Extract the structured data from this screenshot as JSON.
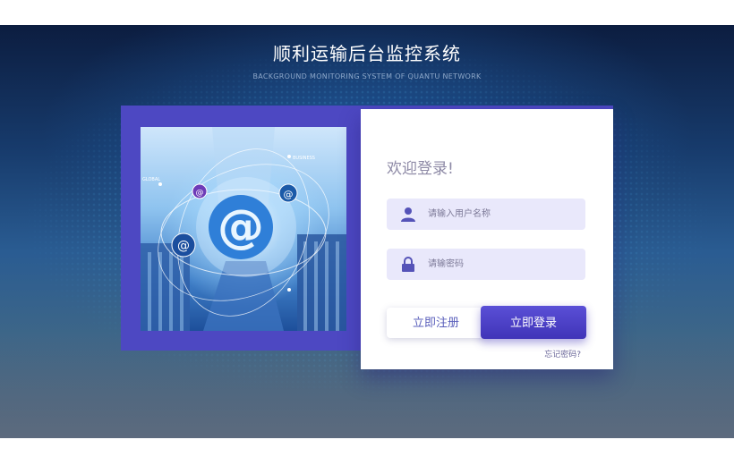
{
  "header": {
    "title": "顺利运输后台监控系统",
    "subtitle": "BACKGROUND MONITORING SYSTEM OF QUANTU NETWORK"
  },
  "illustration": {
    "labels": [
      "GLOBAL",
      "BUSINESS"
    ],
    "symbol": "@"
  },
  "login": {
    "welcome": "欢迎登录!",
    "username_placeholder": "请输入用户名称",
    "username_value": "",
    "password_placeholder": "请输密码",
    "password_value": "",
    "register_label": "立即注册",
    "login_label": "立即登录",
    "forgot_label": "忘记密码?"
  },
  "icons": {
    "username": "user-icon",
    "password": "lock-icon"
  },
  "colors": {
    "accent": "#4d48c2",
    "button_primary": "#4a3fc6",
    "field_background": "#e9e8fb",
    "background_dark": "#0c1d40"
  }
}
